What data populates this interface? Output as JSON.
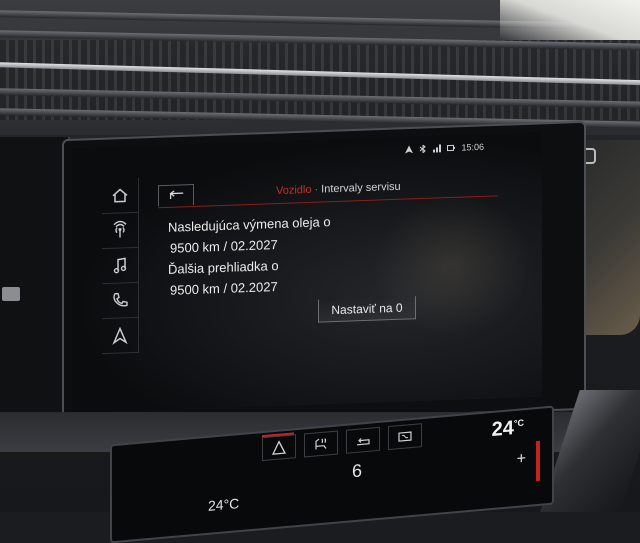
{
  "status_bar": {
    "time": "15:06",
    "icons": [
      "navigation-icon",
      "bluetooth-icon",
      "signal-icon",
      "battery-icon"
    ]
  },
  "sidebar": {
    "items": [
      {
        "name": "home",
        "icon": "home-icon"
      },
      {
        "name": "radio",
        "icon": "radio-icon"
      },
      {
        "name": "media",
        "icon": "music-note-icon"
      },
      {
        "name": "phone",
        "icon": "phone-icon"
      },
      {
        "name": "navigation",
        "icon": "navigation-arrow-icon"
      }
    ]
  },
  "header": {
    "back_icon": "back-arrow-icon",
    "breadcrumb_parent": "Vozidlo",
    "breadcrumb_separator": "·",
    "breadcrumb_current": "Intervaly servisu"
  },
  "service": {
    "oil_label": "Nasledujúca výmena oleja o",
    "oil_value": "9500 km  /  02.2027",
    "inspection_label": "Ďalšia prehliadka o",
    "inspection_value": "9500 km  /  02.2027"
  },
  "actions": {
    "reset_label": "Nastaviť na 0"
  },
  "climate": {
    "right_temp": "24",
    "right_temp_unit": "°C",
    "fan_level": "6",
    "left_temp": "24°C",
    "plus": "+"
  },
  "colors": {
    "accent": "#d22a2a",
    "text": "#ececec",
    "screen_bg": "#0b0c0e"
  }
}
